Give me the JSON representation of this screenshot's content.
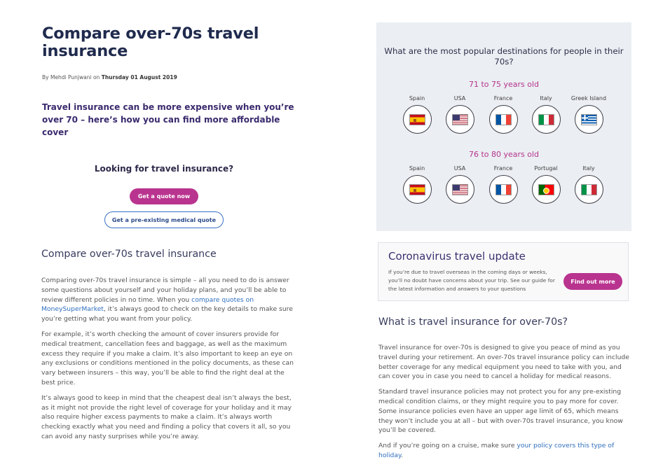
{
  "article": {
    "title": "Compare over-70s travel insurance",
    "byline_prefix": "By Mehdi Punjwani on ",
    "byline_date": "Thursday 01 August 2019",
    "standfirst": "Travel insurance can be more expensive when you’re over 70 – here’s how you can find more affordable cover"
  },
  "cta": {
    "heading": "Looking for travel insurance?",
    "quote_label": "Get a quote now",
    "medical_label": "Get a pre-existing medical quote"
  },
  "compare_section": {
    "heading": "Compare over-70s travel insurance",
    "p1_before": "Comparing over-70s travel insurance is simple – all you need to do is answer some questions about yourself and your holiday plans, and you’ll be able to review different policies in no time. When you ",
    "p1_link": "compare quotes on MoneySuperMarket",
    "p1_after": ", it’s always good to check on the key details to make sure you’re getting what you want from your policy.",
    "p2": "For example, it’s worth checking the amount of cover insurers provide for medical treatment, cancellation fees and baggage, as well as the maximum excess they require if you make a claim. It’s also important to keep an eye on any exclusions or conditions mentioned in the policy documents, as these can vary between insurers – this way, you’ll be able to find the right deal at the best price.",
    "p3": "It’s always good to keep in mind that the cheapest deal isn’t always the best, as it might not provide the right level of coverage for your holiday and it may also require higher excess payments to make a claim. It’s always worth checking exactly what you need and finding a policy that covers it all, so you can avoid any nasty surprises while you’re away."
  },
  "destinations": {
    "title": "What are the most popular destinations for people in their 70s?",
    "group1": {
      "label": "71 to 75 years old",
      "items": [
        {
          "name": "Spain",
          "flag": "spain-flag"
        },
        {
          "name": "USA",
          "flag": "usa-flag"
        },
        {
          "name": "France",
          "flag": "france-flag"
        },
        {
          "name": "Italy",
          "flag": "italy-flag"
        },
        {
          "name": "Greek Island",
          "flag": "greece-flag"
        }
      ]
    },
    "group2": {
      "label": "76 to 80 years old",
      "items": [
        {
          "name": "Spain",
          "flag": "spain-flag"
        },
        {
          "name": "USA",
          "flag": "usa-flag"
        },
        {
          "name": "France",
          "flag": "france-flag"
        },
        {
          "name": "Portugal",
          "flag": "portugal-flag"
        },
        {
          "name": "Italy",
          "flag": "italy-flag"
        }
      ]
    }
  },
  "corona": {
    "title": "Coronavirus travel update",
    "text": "If you’re due to travel overseas in the coming days or weeks, you’ll no doubt have concerns about your trip. See our guide for the latest information and answers to your questions",
    "button_label": "Find out more"
  },
  "what_section": {
    "heading": "What is travel insurance for over-70s?",
    "p1": "Travel insurance for over-70s is designed to give you peace of mind as you travel during your retirement. An over-70s travel insurance policy can include better coverage for any medical equipment you need to take with you, and can cover you in case you need to cancel a holiday for medical reasons.",
    "p2": "Standard travel insurance policies may not protect you for any pre-existing medical condition claims, or they might require you to pay more for cover. Some insurance policies even have an upper age limit of 65, which means they won’t include you at all – but with over-70s travel insurance, you know you’ll be covered.",
    "p3_before": "And if you’re going on a cruise, make sure ",
    "p3_link": "your policy covers this type of holiday",
    "p3_after": "."
  },
  "colors": {
    "accent": "#b9348f",
    "heading": "#1f2a4d",
    "link": "#2f6fbe",
    "panel_bg": "#ebeef2"
  }
}
